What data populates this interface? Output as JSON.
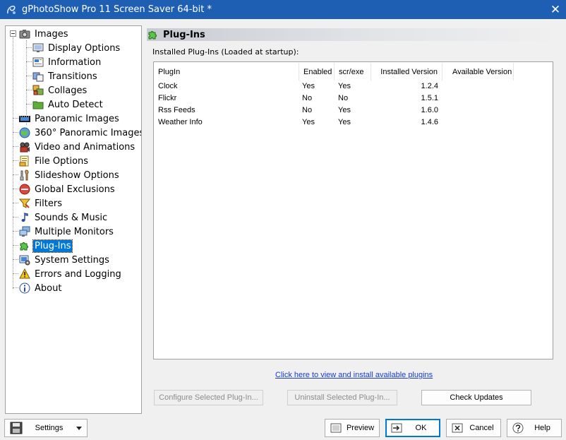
{
  "window": {
    "title": "gPhotoShow Pro 11 Screen Saver 64-bit *",
    "close_glyph": "✕"
  },
  "tree": {
    "items": [
      {
        "label": "Images",
        "icon": "camera-icon"
      },
      {
        "label": "Display Options",
        "icon": "monitor-icon"
      },
      {
        "label": "Information",
        "icon": "info-panel-icon"
      },
      {
        "label": "Transitions",
        "icon": "transitions-icon"
      },
      {
        "label": "Collages",
        "icon": "collage-icon"
      },
      {
        "label": "Auto Detect",
        "icon": "folder-green-icon"
      },
      {
        "label": "Panoramic Images",
        "icon": "film-strip-icon"
      },
      {
        "label": "360° Panoramic Images",
        "icon": "globe-icon"
      },
      {
        "label": "Video and Animations",
        "icon": "video-icon"
      },
      {
        "label": "File Options",
        "icon": "file-options-icon"
      },
      {
        "label": "Slideshow Options",
        "icon": "tools-icon"
      },
      {
        "label": "Global Exclusions",
        "icon": "no-entry-icon"
      },
      {
        "label": "Filters",
        "icon": "filter-icon"
      },
      {
        "label": "Sounds & Music",
        "icon": "music-note-icon"
      },
      {
        "label": "Multiple Monitors",
        "icon": "monitors-icon"
      },
      {
        "label": "Plug-Ins",
        "icon": "puzzle-icon"
      },
      {
        "label": "System Settings",
        "icon": "system-settings-icon"
      },
      {
        "label": "Errors and Logging",
        "icon": "warning-icon"
      },
      {
        "label": "About",
        "icon": "about-icon"
      }
    ],
    "selected": "Plug-Ins"
  },
  "plugins": {
    "header_title": "Plug-Ins",
    "installed_label": "Installed Plug-Ins (Loaded at startup):",
    "columns": [
      "PlugIn",
      "Enabled",
      "scr/exe",
      "Installed Version",
      "Available Version"
    ],
    "rows": [
      {
        "name": "Clock",
        "enabled": "Yes",
        "screxe": "Yes",
        "installed": "1.2.4",
        "available": ""
      },
      {
        "name": "Flickr",
        "enabled": "No",
        "screxe": "No",
        "installed": "1.5.1",
        "available": ""
      },
      {
        "name": "Rss Feeds",
        "enabled": "No",
        "screxe": "Yes",
        "installed": "1.6.0",
        "available": ""
      },
      {
        "name": "Weather Info",
        "enabled": "Yes",
        "screxe": "Yes",
        "installed": "1.4.6",
        "available": ""
      }
    ],
    "link_text": "Click here to view and install available plugins",
    "configure_label": "Configure Selected Plug-In...",
    "uninstall_label": "Uninstall Selected Plug-In...",
    "check_updates_label": "Check Updates"
  },
  "footer": {
    "settings_label": "Settings",
    "preview_label": "Preview",
    "ok_label": "OK",
    "cancel_label": "Cancel",
    "help_label": "Help"
  },
  "colors": {
    "titlebar": "#1f5fb3",
    "selection": "#0078d7",
    "link": "#1a3cd1"
  }
}
